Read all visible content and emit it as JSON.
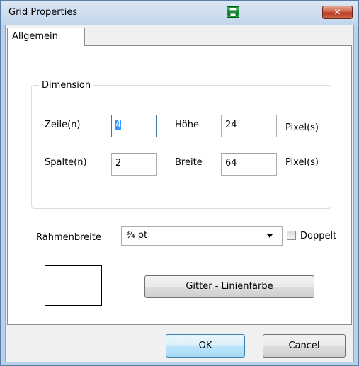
{
  "window": {
    "title": "Grid Properties",
    "close_glyph": "✕",
    "app_icon": "green-printer-icon"
  },
  "tabs": [
    {
      "label": "Allgemein",
      "selected": true
    }
  ],
  "dimension": {
    "group_label": "Dimension",
    "rows_label": "Zeile(n)",
    "rows_value": "4",
    "height_label": "Höhe",
    "height_value": "24",
    "height_unit": "Pixel(s)",
    "cols_label": "Spalte(n)",
    "cols_value": "2",
    "width_label": "Breite",
    "width_value": "64",
    "width_unit": "Pixel(s)"
  },
  "border": {
    "label": "Rahmenbreite",
    "selected": "¾ pt",
    "double_label": "Doppelt",
    "double_checked": false
  },
  "color_button_label": "Gitter - Linienfarbe",
  "footer": {
    "ok_label": "OK",
    "cancel_label": "Cancel"
  },
  "colors": {
    "title_bar": "#c2d6ec",
    "close_button": "#c75a3e",
    "selection": "#3399ff"
  }
}
